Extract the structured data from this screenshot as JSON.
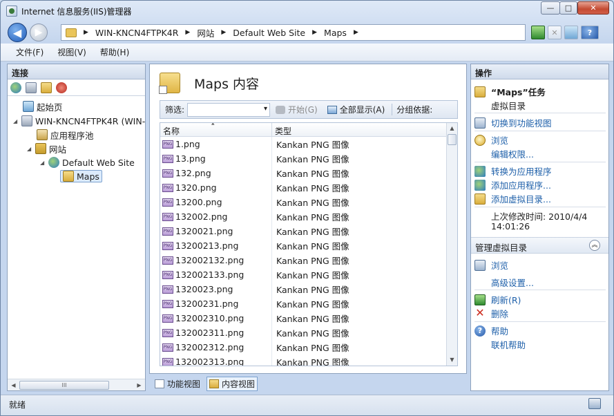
{
  "window": {
    "title": "Internet 信息服务(IIS)管理器",
    "min_glyph": "—",
    "max_glyph": "□",
    "close_glyph": "✕"
  },
  "nav": {
    "back_glyph": "◀",
    "forward_glyph": "▶",
    "breadcrumb": [
      "WIN-KNCN4FTPK4R",
      "网站",
      "Default Web Site",
      "Maps"
    ],
    "separator": "▶",
    "right_icons": [
      "refresh-icon",
      "stop-icon",
      "home-icon",
      "help-icon"
    ],
    "help_glyph": "?"
  },
  "menu": {
    "items": [
      "文件(F)",
      "视图(V)",
      "帮助(H)"
    ]
  },
  "connections": {
    "title": "连接",
    "tree": [
      {
        "label": "起始页",
        "icon": "home-icon",
        "level": 0
      },
      {
        "label": "WIN-KNCN4FTPK4R (WIN-",
        "icon": "server-icon",
        "level": 0
      },
      {
        "label": "应用程序池",
        "icon": "app-pool-icon",
        "level": 1
      },
      {
        "label": "网站",
        "icon": "sites-icon",
        "level": 1
      },
      {
        "label": "Default Web Site",
        "icon": "globe-icon",
        "level": 2
      },
      {
        "label": "Maps",
        "icon": "folder-icon",
        "level": 3
      }
    ],
    "expander_open": "◢",
    "scroll_left": "◀",
    "scroll_right": "▶",
    "scroll_thumb": "III"
  },
  "content": {
    "title": "Maps 内容",
    "filter_label": "筛选:",
    "start_label": "开始(G)",
    "show_all_label": "全部显示(A)",
    "group_by_label": "分组依据:",
    "columns": [
      "名称",
      "类型"
    ],
    "file_icon_text": "PNG",
    "rows": [
      {
        "name": "1.png",
        "type": "Kankan PNG 图像"
      },
      {
        "name": "13.png",
        "type": "Kankan PNG 图像"
      },
      {
        "name": "132.png",
        "type": "Kankan PNG 图像"
      },
      {
        "name": "1320.png",
        "type": "Kankan PNG 图像"
      },
      {
        "name": "13200.png",
        "type": "Kankan PNG 图像"
      },
      {
        "name": "132002.png",
        "type": "Kankan PNG 图像"
      },
      {
        "name": "1320021.png",
        "type": "Kankan PNG 图像"
      },
      {
        "name": "13200213.png",
        "type": "Kankan PNG 图像"
      },
      {
        "name": "132002132.png",
        "type": "Kankan PNG 图像"
      },
      {
        "name": "132002133.png",
        "type": "Kankan PNG 图像"
      },
      {
        "name": "1320023.png",
        "type": "Kankan PNG 图像"
      },
      {
        "name": "13200231.png",
        "type": "Kankan PNG 图像"
      },
      {
        "name": "132002310.png",
        "type": "Kankan PNG 图像"
      },
      {
        "name": "132002311.png",
        "type": "Kankan PNG 图像"
      },
      {
        "name": "132002312.png",
        "type": "Kankan PNG 图像"
      },
      {
        "name": "132002313.png",
        "type": "Kankan PNG 图像"
      }
    ],
    "scroll_up": "▲",
    "scroll_down": "▼",
    "view_tabs": [
      "功能视图",
      "内容视图"
    ],
    "active_view": "内容视图"
  },
  "actions": {
    "title": "操作",
    "task_title": "“Maps”任务",
    "task_subtitle": "虚拟目录",
    "switch_feature_view": "切换到功能视图",
    "browse": "浏览",
    "edit_permissions": "编辑权限...",
    "convert_to_app": "转换为应用程序",
    "add_app": "添加应用程序...",
    "add_vdir": "添加虚拟目录...",
    "last_modified_label": "上次修改时间: 2010/4/4",
    "last_modified_time": "14:01:26",
    "manage_group": "管理虚拟目录",
    "collapse_glyph": "︽",
    "browse2": "浏览",
    "advanced": "高级设置...",
    "refresh": "刷新(R)",
    "delete": "删除",
    "delete_glyph": "✕",
    "help": "帮助",
    "online_help": "联机帮助",
    "help_glyph": "?"
  },
  "status": {
    "text": "就绪"
  }
}
